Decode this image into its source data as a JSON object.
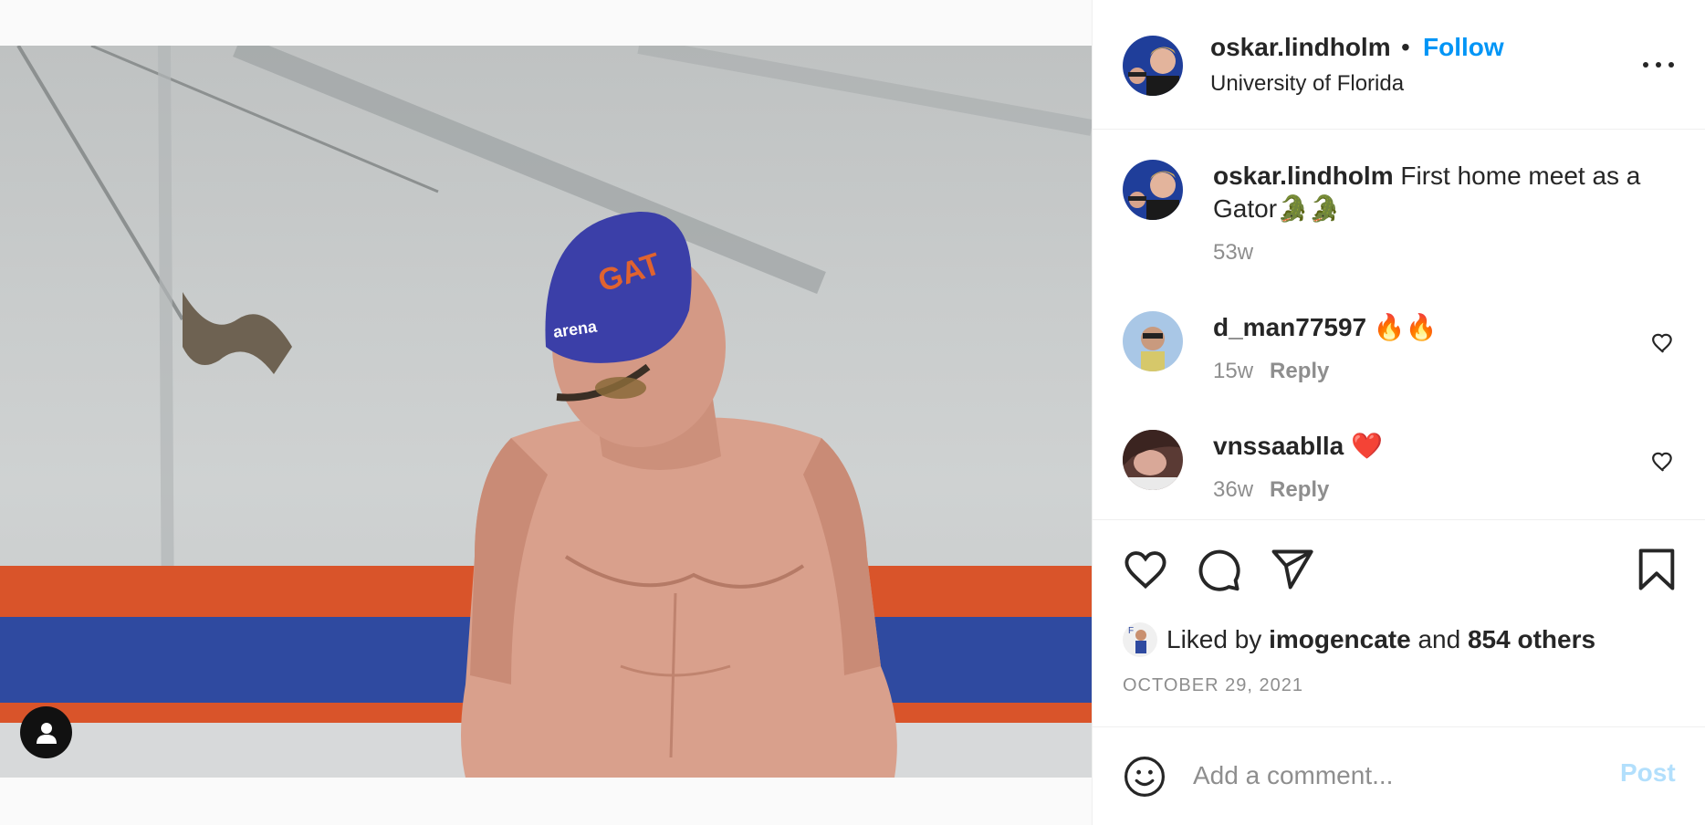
{
  "post": {
    "author": "oskar.lindholm",
    "separator": "•",
    "follow_label": "Follow",
    "location": "University of Florida"
  },
  "icons": {
    "more": "more-options-icon",
    "like": "heart-icon",
    "comment": "comment-icon",
    "share": "paper-plane-icon",
    "save": "bookmark-icon",
    "emoji": "smiley-icon",
    "tag": "user-tag-icon"
  },
  "caption": {
    "author": "oskar.lindholm",
    "text": " First home meet as a Gator🐊🐊",
    "age": "53w"
  },
  "comments": [
    {
      "author": "d_man77597",
      "text": " 🔥🔥",
      "age": "15w",
      "reply_label": "Reply"
    },
    {
      "author": "vnssaablla",
      "text": " ❤️",
      "age": "36w",
      "reply_label": "Reply"
    }
  ],
  "likes": {
    "prefix": "Liked by ",
    "user": "imogencate",
    "middle": " and ",
    "others": "854 others"
  },
  "date": "OCTOBER 29, 2021",
  "add_comment": {
    "placeholder": "Add a comment...",
    "post_label": "Post"
  },
  "colors": {
    "follow": "#0095f6",
    "post_disabled": "#b2dffc",
    "secondary_text": "#8e8e8e",
    "cap_blue": "#3b3fa8",
    "wall_orange": "#d9542a",
    "wall_blue": "#2f4aa0"
  }
}
